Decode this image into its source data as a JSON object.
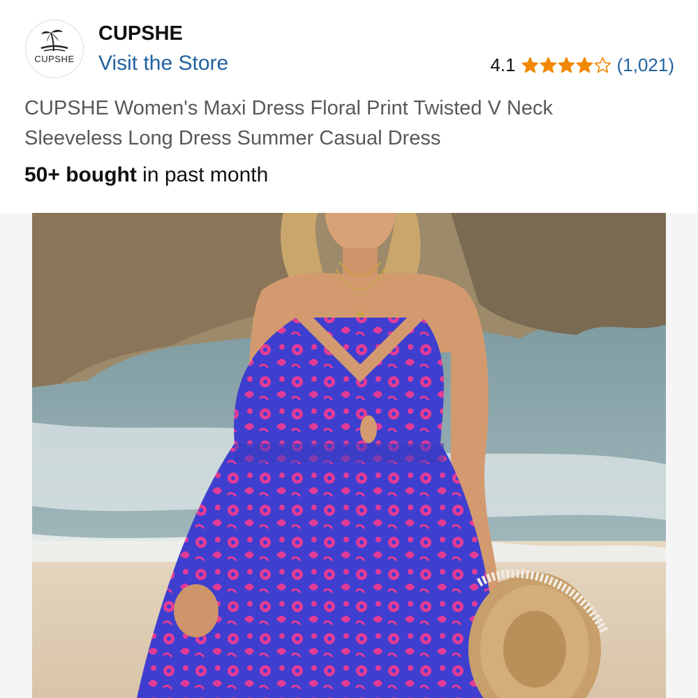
{
  "brand": {
    "logo_text": "CUPSHE",
    "name": "CUPSHE",
    "store_link": "Visit the Store"
  },
  "rating": {
    "value": "4.1",
    "stars": 4.1,
    "count": "(1,021)",
    "star_color": "#f08804"
  },
  "product": {
    "title": "CUPSHE Women's Maxi Dress Floral Print Twisted V Neck Sleeveless Long Dress Summer Casual Dress",
    "bought_bold": "50+ bought",
    "bought_rest": " in past month",
    "image_icon": "product-photo"
  },
  "colors": {
    "link": "#2162a1",
    "text": "#0f1111",
    "muted": "#565959"
  }
}
